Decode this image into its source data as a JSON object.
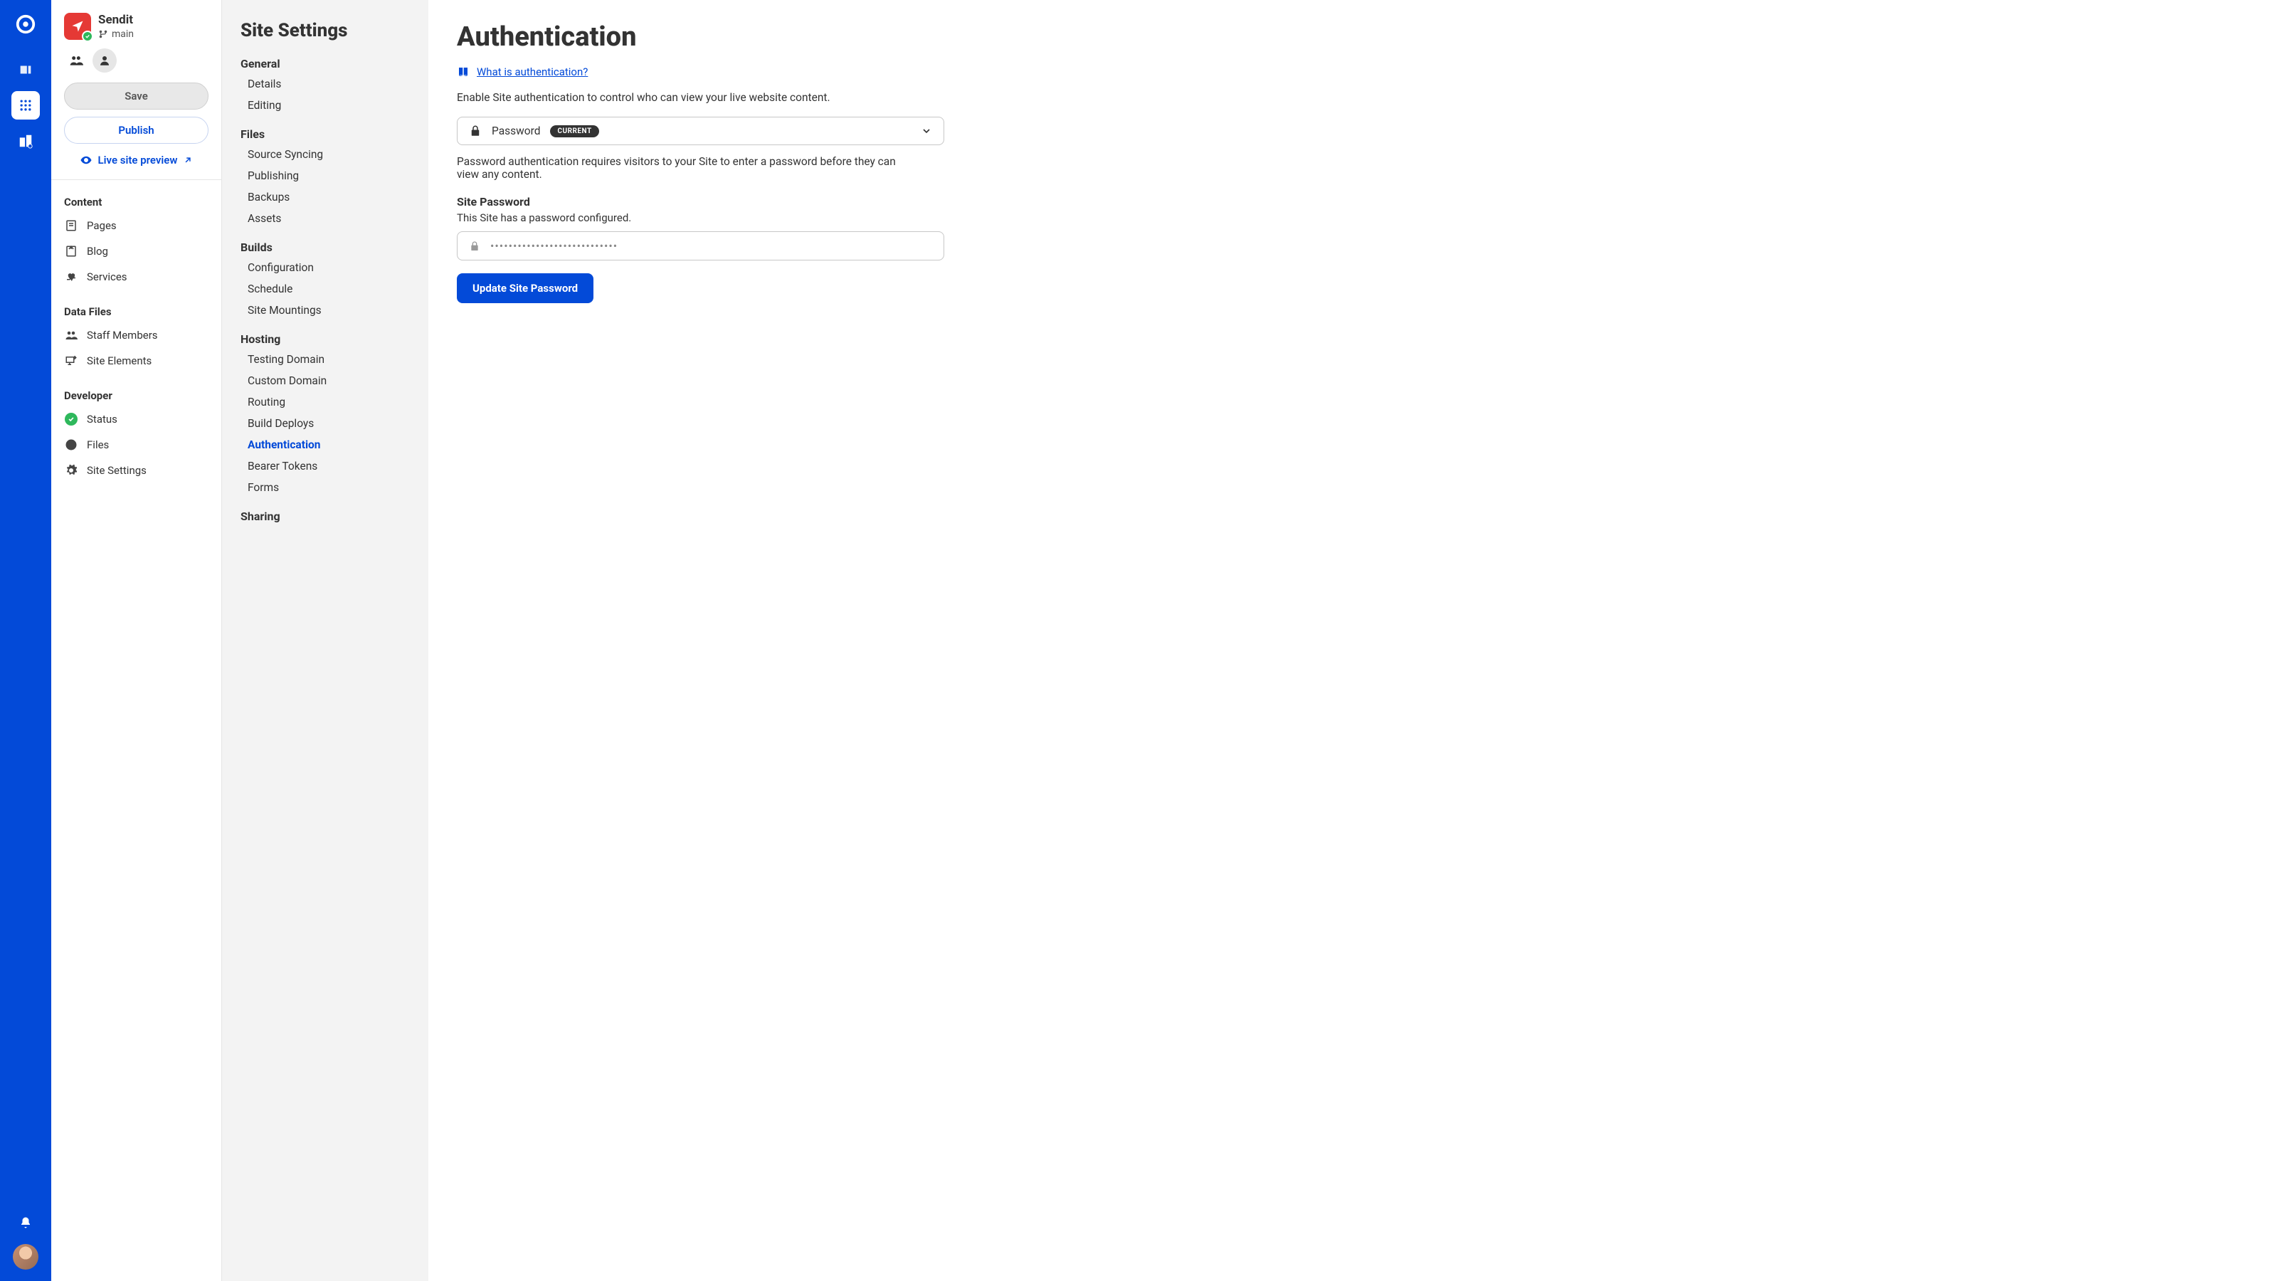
{
  "rail": {
    "logo": "app-logo"
  },
  "project": {
    "name": "Sendit",
    "branch": "main"
  },
  "actions": {
    "save": "Save",
    "publish": "Publish",
    "preview": "Live site preview"
  },
  "sidebar": {
    "sections": [
      {
        "title": "Content",
        "items": [
          {
            "icon": "page",
            "label": "Pages"
          },
          {
            "icon": "blog",
            "label": "Blog"
          },
          {
            "icon": "services",
            "label": "Services"
          }
        ]
      },
      {
        "title": "Data Files",
        "items": [
          {
            "icon": "staff",
            "label": "Staff Members"
          },
          {
            "icon": "elements",
            "label": "Site Elements"
          }
        ]
      },
      {
        "title": "Developer",
        "items": [
          {
            "icon": "status",
            "label": "Status"
          },
          {
            "icon": "files",
            "label": "Files"
          },
          {
            "icon": "settings",
            "label": "Site Settings"
          }
        ]
      }
    ]
  },
  "settings": {
    "title": "Site Settings",
    "groups": [
      {
        "title": "General",
        "items": [
          "Details",
          "Editing"
        ]
      },
      {
        "title": "Files",
        "items": [
          "Source Syncing",
          "Publishing",
          "Backups",
          "Assets"
        ]
      },
      {
        "title": "Builds",
        "items": [
          "Configuration",
          "Schedule",
          "Site Mountings"
        ]
      },
      {
        "title": "Hosting",
        "items": [
          "Testing Domain",
          "Custom Domain",
          "Routing",
          "Build Deploys",
          "Authentication",
          "Bearer Tokens",
          "Forms"
        ]
      },
      {
        "title": "Sharing",
        "items": []
      }
    ],
    "active": "Authentication"
  },
  "main": {
    "title": "Authentication",
    "help_link": "What is authentication?",
    "enable_description": "Enable Site authentication to control who can view your live website content.",
    "auth_method": "Password",
    "auth_badge": "CURRENT",
    "password_description": "Password authentication requires visitors to your Site to enter a password before they can view any content.",
    "password_section_title": "Site Password",
    "password_configured": "This Site has a password configured.",
    "password_value": "••••••••••••••••••••••••••••",
    "update_button": "Update Site Password"
  }
}
